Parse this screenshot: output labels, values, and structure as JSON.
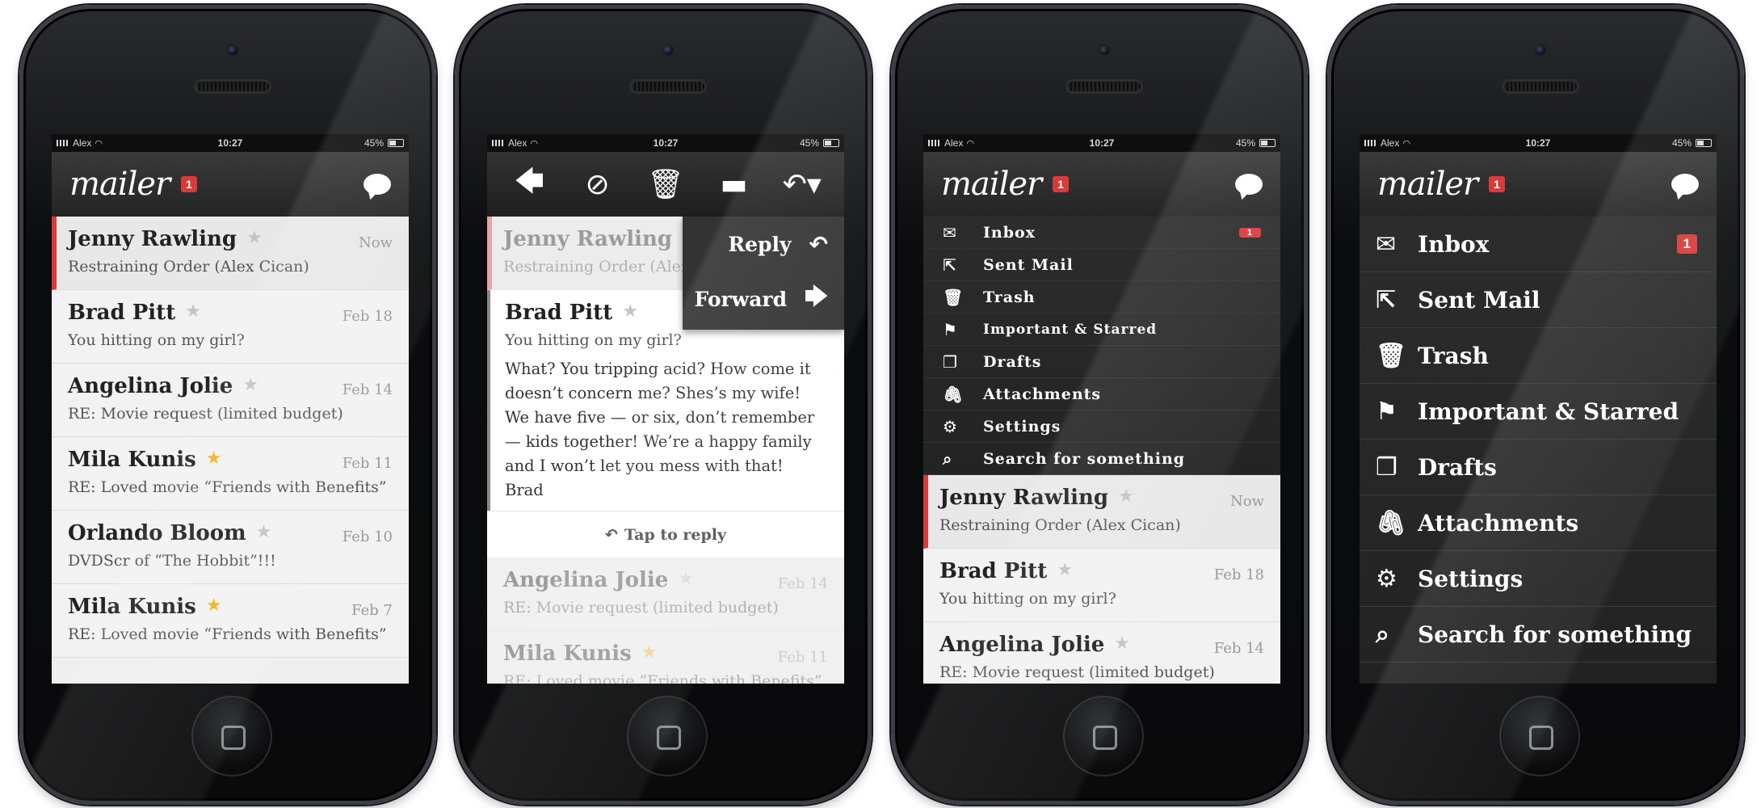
{
  "status": {
    "carrier": "Alex",
    "time": "10:27",
    "battery": "45%"
  },
  "app": {
    "logo": "mailer",
    "badge": "1"
  },
  "emails": [
    {
      "sender": "Jenny Rawling",
      "subject": "Restraining Order (Alex Cican)",
      "date": "Now",
      "starred": false,
      "unread": true
    },
    {
      "sender": "Brad Pitt",
      "subject": "You hitting on my girl?",
      "date": "Feb 18",
      "starred": false,
      "unread": false
    },
    {
      "sender": "Angelina Jolie",
      "subject": "RE: Movie request (limited budget)",
      "date": "Feb 14",
      "starred": false,
      "unread": false
    },
    {
      "sender": "Mila Kunis",
      "subject": "RE: Loved movie “Friends with Benefits”",
      "date": "Feb 11",
      "starred": true,
      "unread": false
    },
    {
      "sender": "Orlando Bloom",
      "subject": "DVDScr of “The Hobbit”!!!",
      "date": "Feb 10",
      "starred": false,
      "unread": false
    },
    {
      "sender": "Mila Kunis",
      "subject": "RE: Loved movie “Friends with Benefits”",
      "date": "Feb  7",
      "starred": true,
      "unread": false
    }
  ],
  "open_email": {
    "body": "What? You tripping acid? How come it doesn’t concern me? Shes’s my wife! We have five — or six, don’t remember — kids together! We’re a happy family and I won’t let you mess with that!",
    "signature": "Brad",
    "tap_reply": "Tap to reply",
    "subject_partial": "Restraining Order (Alex",
    "subject_partial_2": "RE: Loved movie “Friends with Benefits”"
  },
  "popup": {
    "reply": "Reply",
    "forward": "Forward"
  },
  "menu": {
    "items": [
      {
        "label": "Inbox",
        "icon": "envelope-icon",
        "badge": "1"
      },
      {
        "label": "Sent Mail",
        "icon": "share-icon"
      },
      {
        "label": "Trash",
        "icon": "trash-icon"
      },
      {
        "label": "Important & Starred",
        "icon": "flag-icon"
      },
      {
        "label": "Drafts",
        "icon": "documents-icon"
      },
      {
        "label": "Attachments",
        "icon": "paperclip-icon"
      },
      {
        "label": "Settings",
        "icon": "gear-icon"
      },
      {
        "label": "Search for something",
        "icon": "search-icon"
      }
    ]
  },
  "colors": {
    "accent": "#d93a3a",
    "star": "#f0b323",
    "dark": "#262626"
  }
}
